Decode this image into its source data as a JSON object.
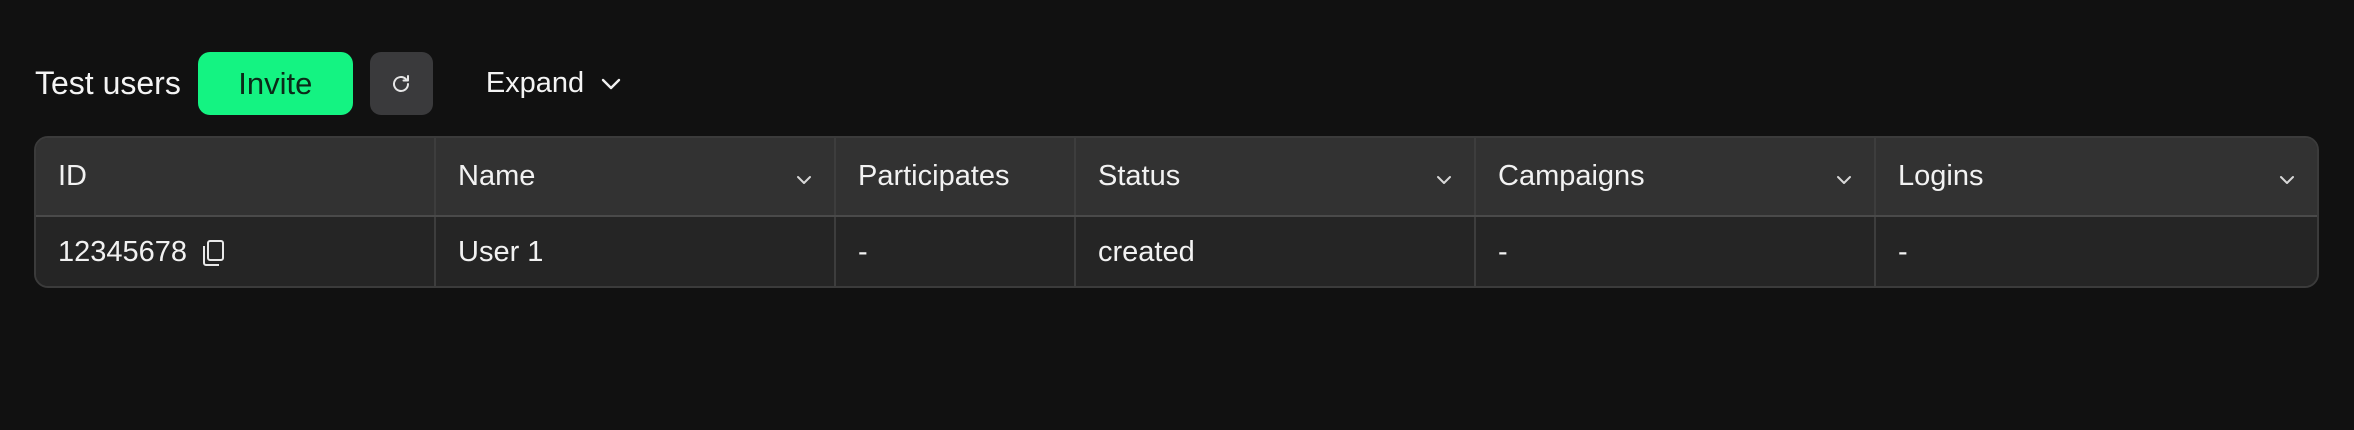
{
  "toolbar": {
    "title": "Test users",
    "invite_label": "Invite",
    "refresh_icon": "refresh-icon",
    "expand_label": "Expand",
    "accent_color": "#14f382"
  },
  "table": {
    "columns": [
      {
        "label": "ID",
        "sortable": false
      },
      {
        "label": "Name",
        "sortable": true
      },
      {
        "label": "Participates",
        "sortable": false
      },
      {
        "label": "Status",
        "sortable": true
      },
      {
        "label": "Campaigns",
        "sortable": true
      },
      {
        "label": "Logins",
        "sortable": true
      }
    ],
    "rows": [
      {
        "id": "12345678",
        "name": "User 1",
        "participates": "-",
        "status": "created",
        "campaigns": "-",
        "logins": "-"
      }
    ]
  }
}
